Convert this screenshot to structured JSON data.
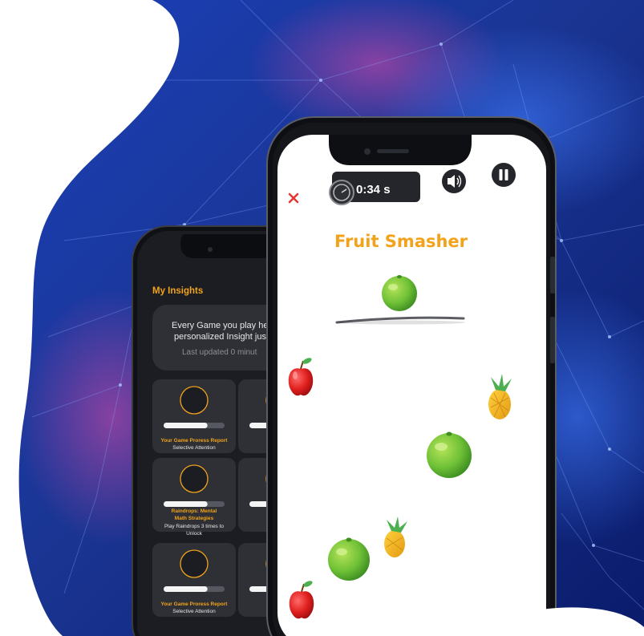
{
  "colors": {
    "accent": "#F2A31B",
    "close": "#E53935",
    "bg_blue_dark": "#0B1E74",
    "bg_blue_light": "#2D5FD9",
    "back_screen": "#1B1D22",
    "card": "#2E3035"
  },
  "back_phone": {
    "title": "My Insights",
    "info_line1": "Every Game you play hel",
    "info_line2": "personalized Insight just",
    "info_updated": "Last updated 0 minut",
    "cards": [
      {
        "title": "Your Game Proress Report",
        "subtitle": "Selective Attention",
        "progress": 0.72
      },
      {
        "title": "Your Ga",
        "subtitle": "Selec",
        "progress": 0.5
      },
      {
        "title_line1": "Raindrops: Mental",
        "title_line2": "Math Strategies",
        "subtitle_line1": "Play Raindrops 3 times to",
        "subtitle_line2": "Unlock",
        "progress": 0.72
      },
      {
        "title_line1": "Raindr",
        "title_line2": "Ma",
        "subtitle_line1": "Play Ra",
        "progress": 0.5
      },
      {
        "title": "Your Game Proress Report",
        "subtitle": "Selective Attention",
        "progress": 0.72
      },
      {
        "title": "Your Ga",
        "subtitle": "Selec",
        "progress": 0.5
      }
    ]
  },
  "front_phone": {
    "timer": "0:34 s",
    "game_title": "Fruit Smasher",
    "icons": {
      "close": "close-icon",
      "timer": "stopwatch-icon",
      "sound": "speaker-icon",
      "pause": "pause-icon"
    },
    "fruits": [
      "lime",
      "apple",
      "pineapple",
      "lime",
      "pineapple",
      "lime",
      "apple"
    ]
  }
}
